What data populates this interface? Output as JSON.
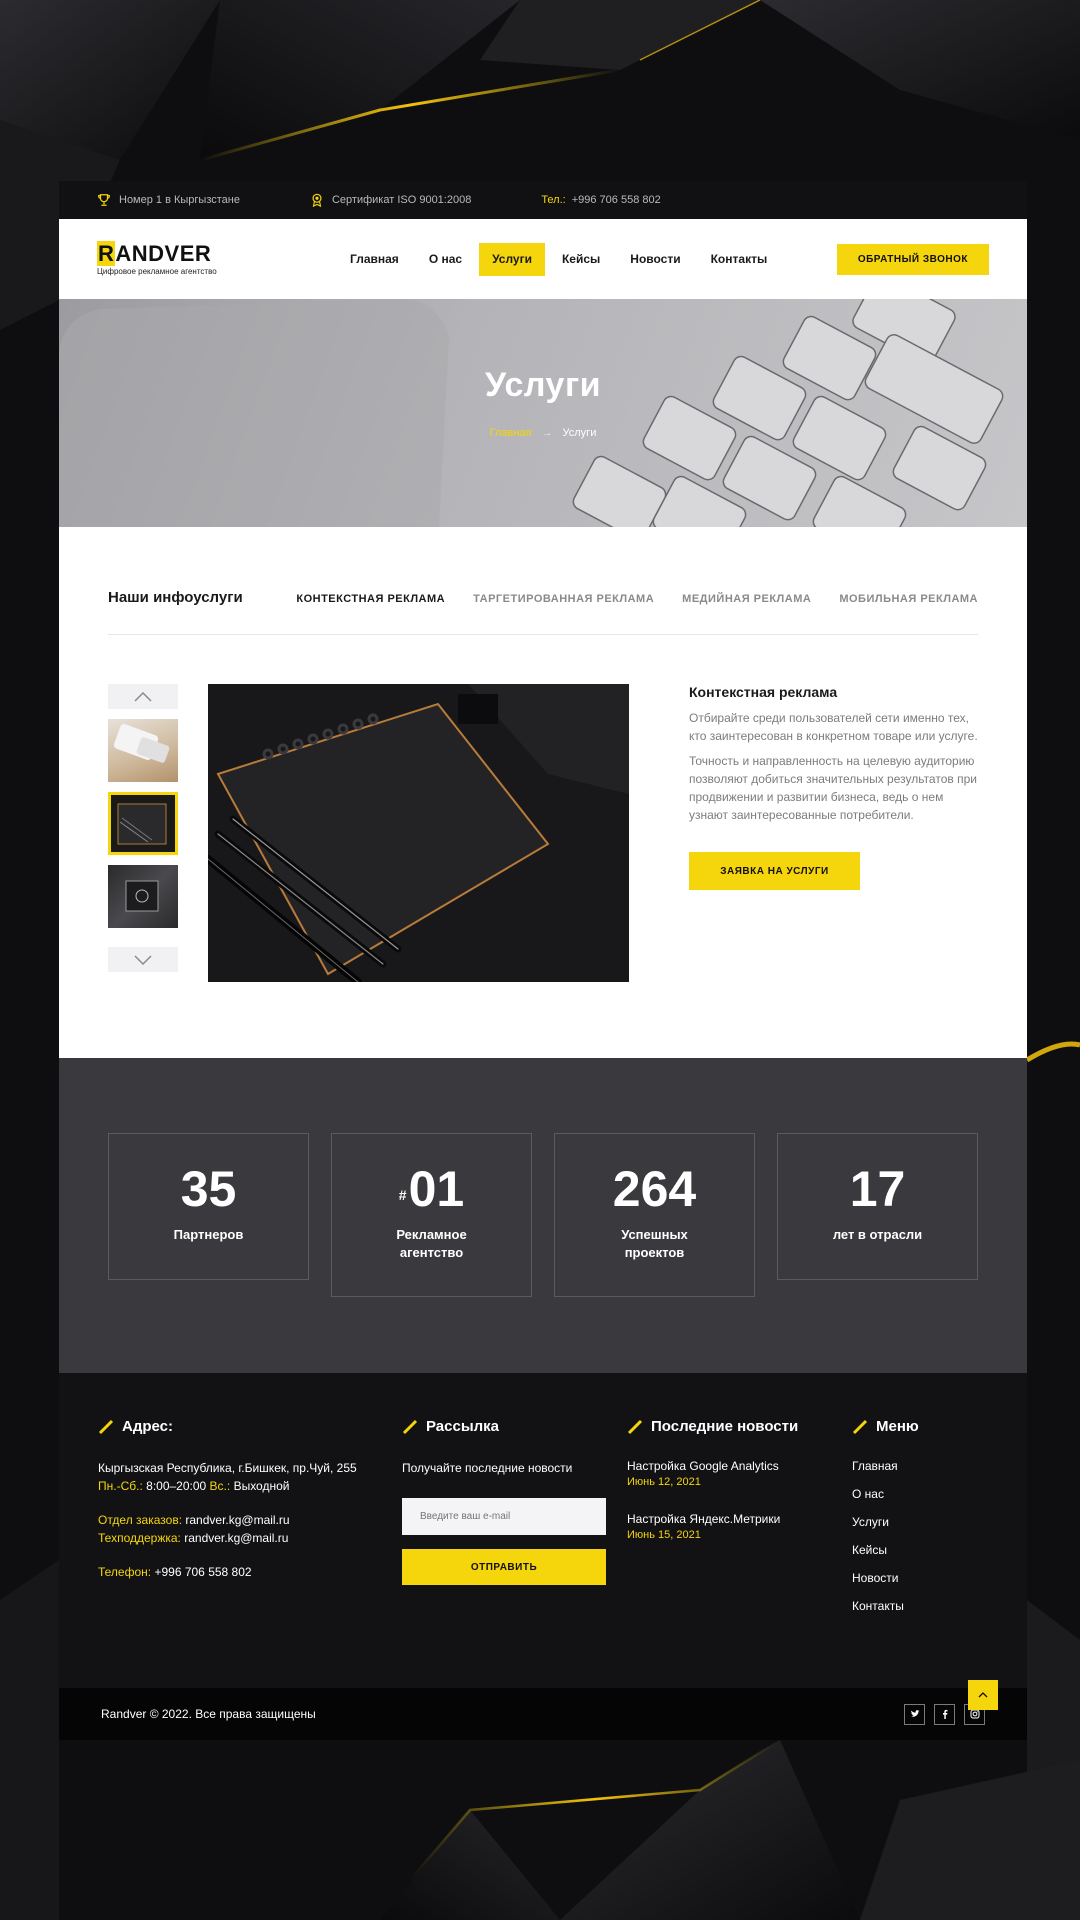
{
  "topbar": {
    "award_text": "Номер 1 в Кыргызстане",
    "certificate_text": "Сертификат ISO 9001:2008",
    "phone_label": "Тел.:",
    "phone_value": "+996 706 558 802"
  },
  "header": {
    "logo_first_letter": "R",
    "logo_rest": "ANDVER",
    "logo_subtitle": "Цифровое рекламное агентство",
    "nav": [
      {
        "label": "Главная"
      },
      {
        "label": "О нас"
      },
      {
        "label": "Услуги"
      },
      {
        "label": "Кейсы"
      },
      {
        "label": "Новости"
      },
      {
        "label": "Контакты"
      }
    ],
    "active_nav": "Услуги",
    "callback_label": "ОБРАТНЫЙ ЗВОНОК"
  },
  "hero": {
    "title": "Услуги",
    "breadcrumb_home": "Главная",
    "breadcrumb_sep": "→",
    "breadcrumb_current": "Услуги"
  },
  "services": {
    "heading": "Наши инфоуслуги",
    "tabs": [
      {
        "label": "КОНТЕКСТНАЯ РЕКЛАМА"
      },
      {
        "label": "ТАРГЕТИРОВАННАЯ РЕКЛАМА"
      },
      {
        "label": "МЕДИЙНАЯ РЕКЛАМА"
      },
      {
        "label": "МОБИЛЬНАЯ РЕКЛАМА"
      }
    ],
    "active_tab": "КОНТЕКСТНАЯ РЕКЛАМА",
    "detail_title": "Контекстная реклама",
    "detail_p1": "Отбирайте среди пользователей сети именно тех, кто заинтересован в конкретном товаре или услуге.",
    "detail_p2": "Точность и направленность на целевую аудиторию позволяют добиться значительных результатов при продвижении и развитии бизнеса, ведь о нем узнают заинтересованные потребители.",
    "order_label": "ЗАЯВКА НА УСЛУГИ"
  },
  "stats": [
    {
      "prefix": "",
      "number": "35",
      "label_line1": "Партнеров",
      "label_line2": ""
    },
    {
      "prefix": "#",
      "number": "01",
      "label_line1": "Рекламное",
      "label_line2": "агентство"
    },
    {
      "prefix": "",
      "number": "264",
      "label_line1": "Успешных",
      "label_line2": "проектов"
    },
    {
      "prefix": "",
      "number": "17",
      "label_line1": "лет в отрасли",
      "label_line2": ""
    }
  ],
  "footer": {
    "address": {
      "heading": "Адрес:",
      "line": "Кыргызская Республика, г.Бишкек, пр.Чуй, 255",
      "hours_label_1": "Пн.-Сб.:",
      "hours_value_1": "8:00–20:00",
      "hours_label_2": "Вс.:",
      "hours_value_2": "Выходной",
      "orders_label": "Отдел заказов:",
      "orders_value": "randver.kg@mail.ru",
      "support_label": "Техподдержка:",
      "support_value": "randver.kg@mail.ru",
      "phone_label": "Телефон:",
      "phone_value": "+996 706 558 802"
    },
    "newsletter": {
      "heading": "Рассылка",
      "text": "Получайте последние новости",
      "placeholder": "Введите ваш e-mail",
      "send_label": "ОТПРАВИТЬ"
    },
    "news": {
      "heading": "Последние новости",
      "items": [
        {
          "title": "Настройка Google Analytics",
          "date": "Июнь 12, 2021"
        },
        {
          "title": "Настройка Яндекс.Метрики",
          "date": "Июнь 15, 2021"
        }
      ]
    },
    "menu": {
      "heading": "Меню",
      "items": [
        {
          "label": "Главная"
        },
        {
          "label": "О нас"
        },
        {
          "label": "Услуги"
        },
        {
          "label": "Кейсы"
        },
        {
          "label": "Новости"
        },
        {
          "label": "Контакты"
        }
      ]
    },
    "copyright": "Randver © 2022. Все права защищены",
    "socials": [
      "twitter-icon",
      "facebook-icon",
      "instagram-icon"
    ]
  },
  "colors": {
    "accent": "#f5d50c",
    "dark": "#121214",
    "stats_bg": "#3a393d"
  }
}
